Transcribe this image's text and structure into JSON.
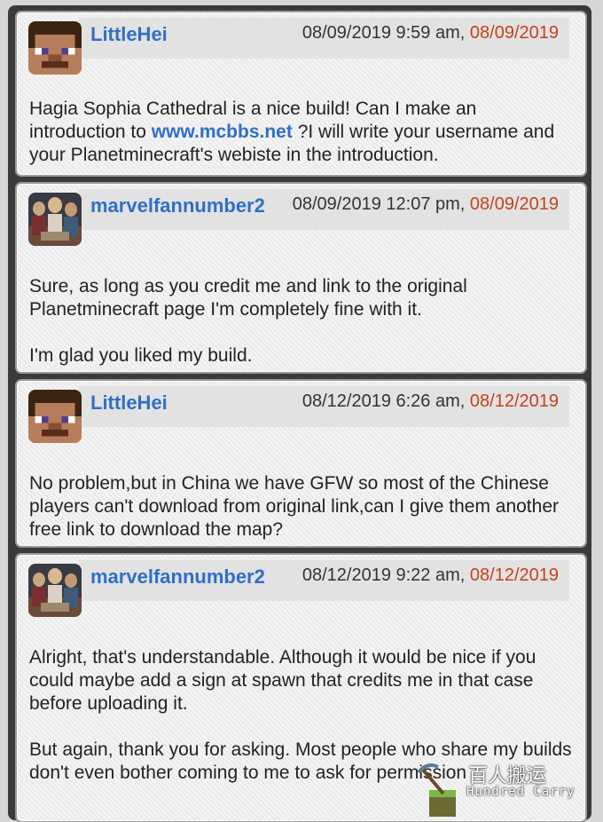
{
  "posts": [
    {
      "username": "LittleHei",
      "avatar": "steve-avatar",
      "time": "08/09/2019 9:59 am, ",
      "date": "08/09/2019",
      "p1_before": "Hagia Sophia Cathedral is a nice build! Can I make an introduction to ",
      "link": "www.mcbbs.net",
      "p1_after": " ?I will write your username and your Planetminecraft's webiste in the introduction."
    },
    {
      "username": "marvelfannumber2",
      "avatar": "painting-avatar",
      "time": "08/09/2019 12:07 pm, ",
      "date": "08/09/2019",
      "p1": "Sure, as long as you credit me and link to the original Planetminecraft page I'm completely fine with it.",
      "p2": "I'm glad you liked my build."
    },
    {
      "username": "LittleHei",
      "avatar": "steve-avatar",
      "time": "08/12/2019 6:26 am, ",
      "date": "08/12/2019",
      "p1": "No problem,but in China we have GFW so most of the Chinese players can't download from original link,can I give them another free link to download the map?"
    },
    {
      "username": "marvelfannumber2",
      "avatar": "painting-avatar",
      "time": "08/12/2019 9:22 am, ",
      "date": "08/12/2019",
      "p1": "Alright, that's understandable. Although it would be nice if you could maybe add a sign at spawn that credits me in that case before uploading it.",
      "p2": "But again, thank you for asking. Most people who share my builds don't even bother coming to me to ask for permission"
    }
  ],
  "watermark": {
    "title": "百人搬运",
    "subtitle": "Hundred Carry"
  },
  "colors": {
    "username": "#2f6fc9",
    "date_accent": "#c6411c",
    "frame": "#3a3a3a"
  }
}
